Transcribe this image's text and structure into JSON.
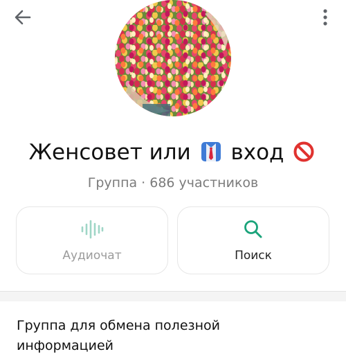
{
  "header": {
    "back_icon": "arrow-left-icon",
    "menu_icon": "more-vertical-icon"
  },
  "profile": {
    "avatar_description": "tulips-bouquet-photo",
    "title_part1": "Женсовет или",
    "title_emoji1": "necktie-shirt-emoji",
    "title_part2": "вход",
    "title_emoji2": "prohibited-emoji",
    "subtitle": "Группа · 686 участников"
  },
  "actions": {
    "audio_label": "Аудиочат",
    "audio_icon": "audio-wave-icon",
    "search_label": "Поиск",
    "search_icon": "search-icon",
    "audio_color": "#9fd6c6",
    "search_color": "#1aa37a"
  },
  "about": {
    "description": "Группа для обмена полезной информацией"
  }
}
